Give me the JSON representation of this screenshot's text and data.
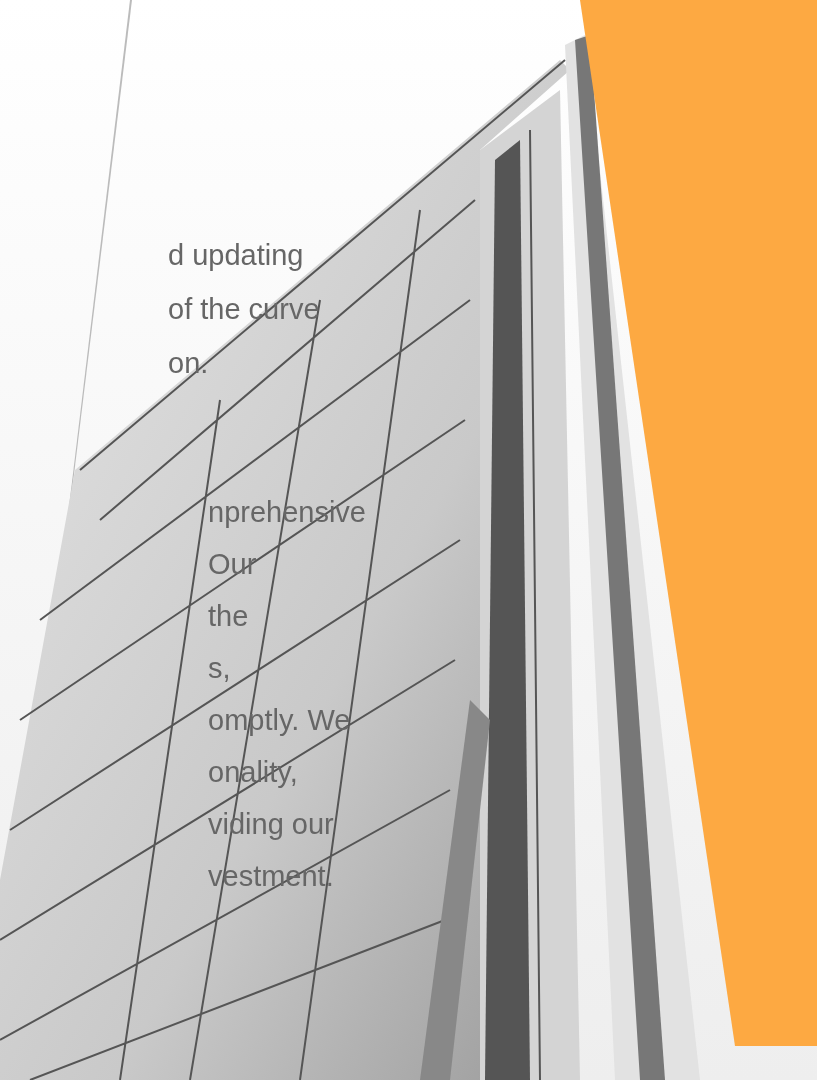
{
  "paragraphs": [
    {
      "lines": [
        "d updating",
        "of the curve",
        "on."
      ]
    },
    {
      "lines": [
        "nprehensive",
        "Our",
        "the",
        "s,",
        "omptly. We",
        "onality,",
        "viding our",
        "vestment."
      ]
    }
  ]
}
